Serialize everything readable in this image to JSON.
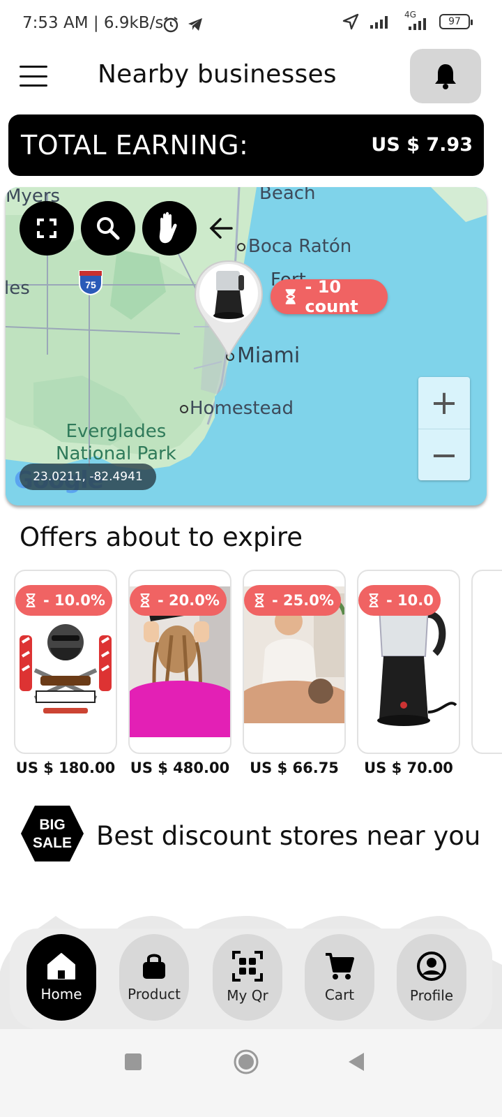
{
  "status_bar": {
    "time": "7:53 AM | 6.9kB/s",
    "network": "4G",
    "battery": "97"
  },
  "header": {
    "title": "Nearby businesses"
  },
  "earning": {
    "label": "TOTAL EARNING:",
    "value": "US $ 7.93"
  },
  "map": {
    "labels": {
      "myers": "Myers",
      "beach": "Beach",
      "boca": "Boca Ratón",
      "les": "les",
      "miami": "Miami",
      "homestead": "Homestead",
      "park": "Everglades\nNational Park",
      "highway": "75",
      "fort": "Fort"
    },
    "count_badge": "- 10 count",
    "coords": "23.0211, -82.4941",
    "zoom_in": "+",
    "zoom_out": "−",
    "google": "Google",
    "colors": {
      "water": "#7fd3ea",
      "land": "#c9e9c9",
      "badge": "#f06363"
    }
  },
  "offers": {
    "title": "Offers about to expire",
    "items": [
      {
        "badge": "- 10.0%",
        "price": "US $ 180.00",
        "image": "barbershop-logo"
      },
      {
        "badge": "- 20.0%",
        "price": "US $ 480.00",
        "image": "hair-salon"
      },
      {
        "badge": "- 25.0%",
        "price": "US $ 66.75",
        "image": "massage"
      },
      {
        "badge": "- 10.0",
        "price": "US $ 70.00",
        "image": "coffee-maker"
      }
    ]
  },
  "big_sale": {
    "badge_line1": "BIG",
    "badge_line2": "SALE",
    "title": "Best discount stores near you"
  },
  "bottom_nav": [
    {
      "label": "Home",
      "icon": "home-icon",
      "active": true
    },
    {
      "label": "Product",
      "icon": "bag-icon",
      "active": false
    },
    {
      "label": "My Qr",
      "icon": "qr-icon",
      "active": false
    },
    {
      "label": "Cart",
      "icon": "cart-icon",
      "active": false
    },
    {
      "label": "Profile",
      "icon": "profile-icon",
      "active": false
    }
  ]
}
